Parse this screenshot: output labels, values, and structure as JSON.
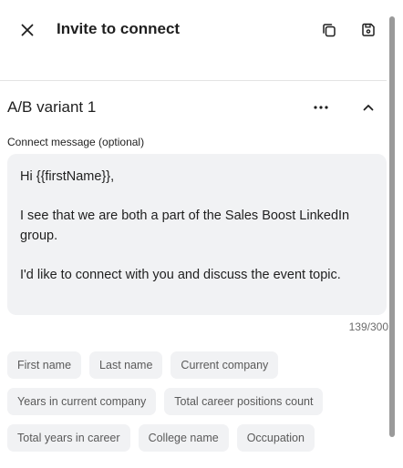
{
  "header": {
    "title": "Invite to connect",
    "close_icon": "close-icon",
    "copy_icon": "copy-icon",
    "save_icon": "save-icon"
  },
  "variant": {
    "title": "A/B variant 1",
    "more_icon": "more-horizontal-icon",
    "collapse_icon": "chevron-up-icon"
  },
  "message": {
    "label": "Connect message (optional)",
    "paragraphs": [
      "Hi {{firstName}},",
      "I see that we are both a part of the Sales Boost LinkedIn group.",
      "I'd like to connect with you and discuss the event topic."
    ],
    "char_count": "139/300"
  },
  "variables": [
    "First name",
    "Last name",
    "Current company",
    "Years in current company",
    "Total career positions count",
    "Total years in career",
    "College name",
    "Occupation"
  ],
  "colors": {
    "chip_bg": "#f1f2f4",
    "text": "#1f1f1f",
    "muted": "#6b6b6b"
  }
}
